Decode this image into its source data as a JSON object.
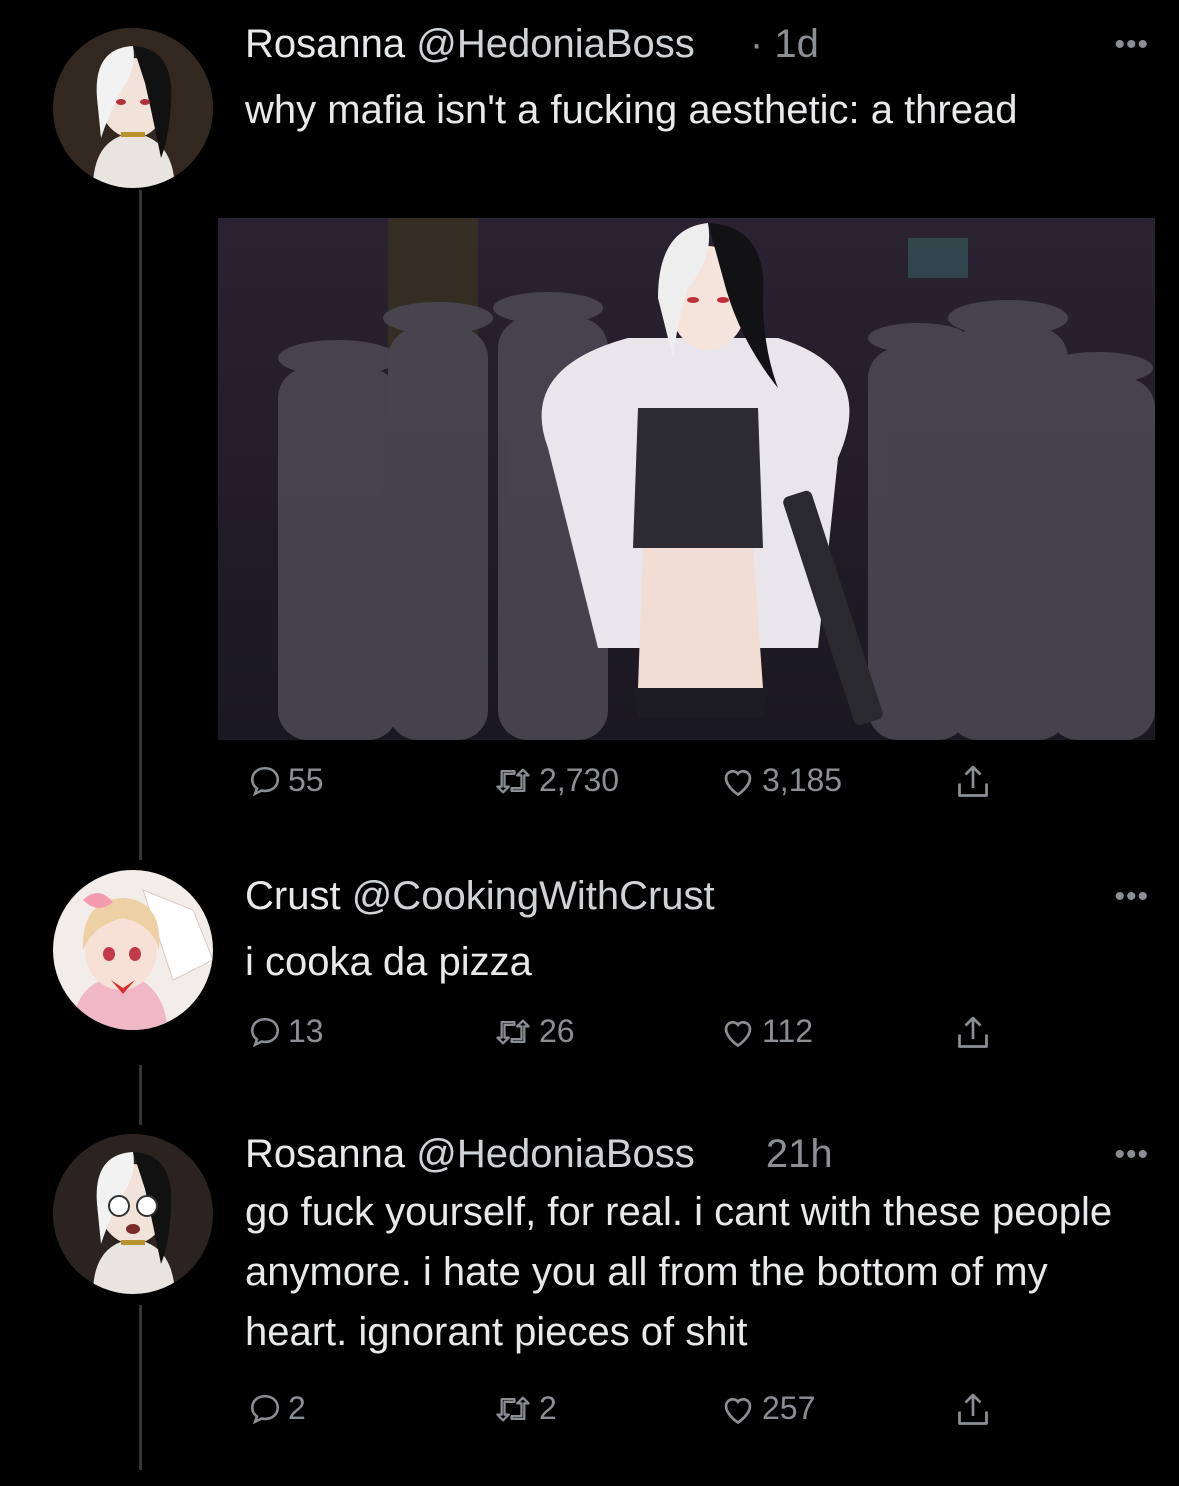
{
  "tweets": [
    {
      "name": "Rosanna",
      "handle": "@HedoniaBoss",
      "time": "· 1d",
      "text": "why mafia isn't a fucking aesthetic: a thread",
      "replies": "55",
      "retweets": "2,730",
      "likes": "3,185",
      "has_media": true
    },
    {
      "name": "Crust",
      "handle": "@CookingWithCrust",
      "time": "",
      "text": "i cooka da pizza",
      "replies": "13",
      "retweets": "26",
      "likes": "112"
    },
    {
      "name": "Rosanna",
      "handle": "@HedoniaBoss",
      "time": "21h",
      "text": "go fuck yourself, for real. i cant with these people anymore. i hate you all from the bottom of my heart. ignorant pieces of shit",
      "replies": "2",
      "retweets": "2",
      "likes": "257"
    }
  ],
  "more_label": "•••",
  "icons": {
    "reply": "reply-icon",
    "retweet": "retweet-icon",
    "like": "heart-icon",
    "share": "share-icon"
  },
  "colors": {
    "background": "#000000",
    "text": "#e7e9ea",
    "muted": "#8b8f94",
    "thread_line": "#333639"
  }
}
